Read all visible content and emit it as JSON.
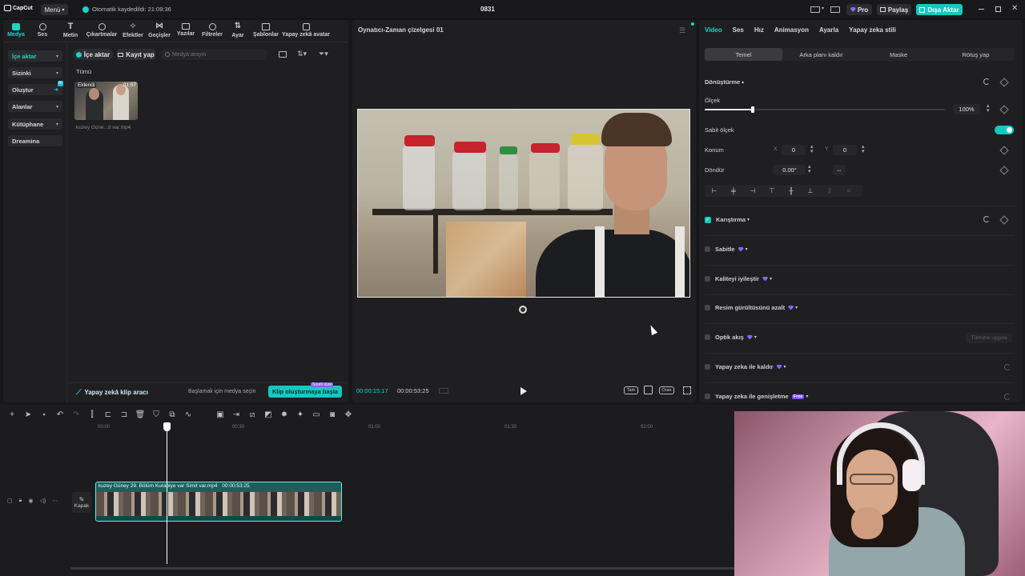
{
  "titlebar": {
    "logo": "CapCut",
    "menu": "Menü",
    "autosave": "Otomatik kaydedildi: 21:09:36",
    "project": "0831",
    "pro": "Pro",
    "share": "Paylaş",
    "export": "Dışa Aktar"
  },
  "toolbar": {
    "items": [
      "Medya",
      "Ses",
      "Metin",
      "Çıkartmalar",
      "Efektler",
      "Geçişler",
      "Yazılar",
      "Filtreler",
      "Ayar",
      "Şablonlar",
      "Yapay zekâ avatar"
    ]
  },
  "sidebar": {
    "items": [
      "İçe aktar",
      "Sizinki",
      "Oluştur",
      "Alanlar",
      "Kütüphane",
      "Dreamina"
    ],
    "oluştur_badge": "AI"
  },
  "media": {
    "import": "İçe aktar",
    "record": "Kayıt yap",
    "search_placeholder": "Medya arayın",
    "filter_all": "Tümü",
    "clip_badge": "Eklendi",
    "clip_duration": "01:07",
    "clip_name": "kuzey Güne...it var.mp4",
    "ai_tool": "Yapay zekâ klip aracı",
    "ai_hint": "Başlamak için medya seçin",
    "ai_btn": "Klip oluşturmaya başla",
    "ai_btn_badge": "Sınırlı süre"
  },
  "player": {
    "title": "Oynatıcı-Zaman çizelgesi 01",
    "time_current": "00:00:15:17",
    "time_total": "00:00:53:25",
    "ratio_btn": "Tam",
    "orig_btn": "Oran"
  },
  "inspector": {
    "tabs": [
      "Video",
      "Ses",
      "Hız",
      "Animasyon",
      "Ayarla",
      "Yapay zeka stili"
    ],
    "subtabs": [
      "Temel",
      "Arka planı kaldır",
      "Maske",
      "Rötuş yap"
    ],
    "transform": "Dönüştürme",
    "scale_label": "Ölçek",
    "scale_value": "100%",
    "scale_level": 0.2,
    "uniform_scale": "Sabit ölçek",
    "position_label": "Konum",
    "pos_x_label": "X",
    "pos_x": "0",
    "pos_y_label": "Y",
    "pos_y": "0",
    "rotate_label": "Döndür",
    "rotate_value": "0.00°",
    "blend": "Karıştırma",
    "stabilize": "Sabitle",
    "enhance": "Kaliteyi iyileştir",
    "denoise": "Resim gürültüsünü azalt",
    "optical": "Optik akış",
    "optical_apply": "Tümüne uygula",
    "ai_remove": "Yapay zeka ile kaldır",
    "ai_expand": "Yapay zeka ile genişletme",
    "free_badge": "Free"
  },
  "timeline": {
    "ticks": [
      "00:00",
      "00:30",
      "01:00",
      "01:30",
      "02:00"
    ],
    "cover": "Kapak",
    "clip_name": "kuzey Güney 29. Bölüm Kurabiye var Simit var.mp4",
    "clip_duration": "00:00:53:25"
  },
  "colors": {
    "accent": "#1fd2c7",
    "export_bg": "#14c9c0",
    "playhead": "#ffffff",
    "clip_border": "#5ff0e6"
  }
}
